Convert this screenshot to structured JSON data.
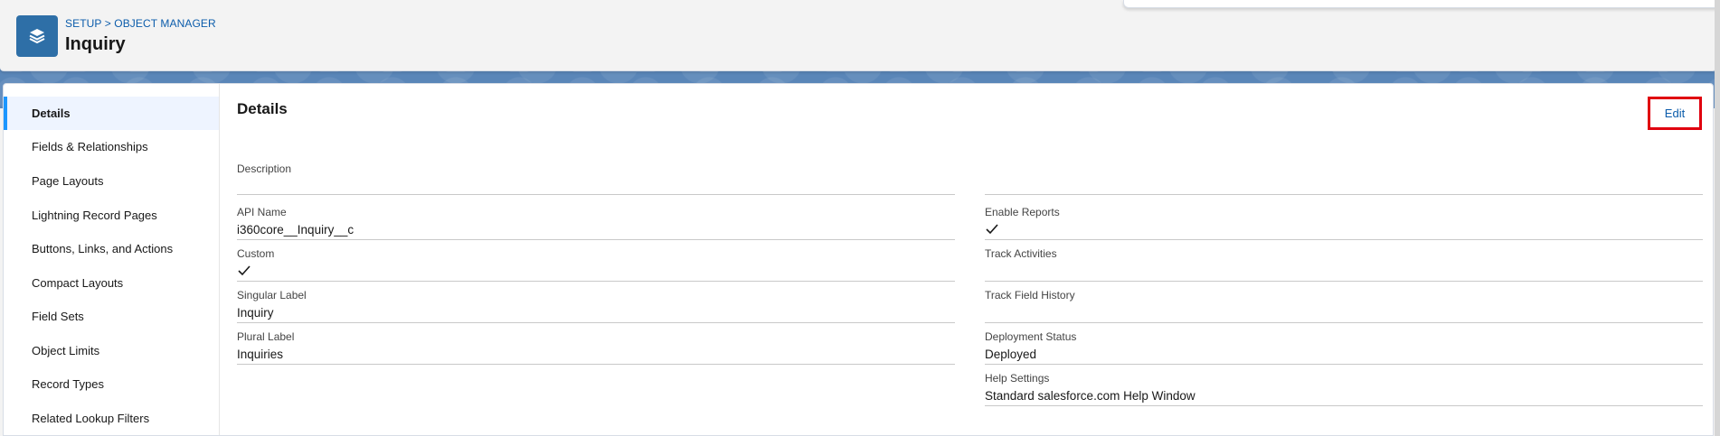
{
  "header": {
    "breadcrumb": "SETUP > OBJECT MANAGER",
    "title": "Inquiry",
    "icon": "layers-icon"
  },
  "sidebar": {
    "items": [
      {
        "label": "Details",
        "active": true
      },
      {
        "label": "Fields & Relationships"
      },
      {
        "label": "Page Layouts"
      },
      {
        "label": "Lightning Record Pages"
      },
      {
        "label": "Buttons, Links, and Actions"
      },
      {
        "label": "Compact Layouts"
      },
      {
        "label": "Field Sets"
      },
      {
        "label": "Object Limits"
      },
      {
        "label": "Record Types"
      },
      {
        "label": "Related Lookup Filters"
      }
    ]
  },
  "details": {
    "title": "Details",
    "edit_label": "Edit",
    "left": {
      "description_label": "Description",
      "description_value": "",
      "api_name_label": "API Name",
      "api_name_value": "i360core__Inquiry__c",
      "custom_label": "Custom",
      "custom_checked": true,
      "singular_label": "Singular Label",
      "singular_value": "Inquiry",
      "plural_label": "Plural Label",
      "plural_value": "Inquiries"
    },
    "right": {
      "enable_reports_label": "Enable Reports",
      "enable_reports_checked": true,
      "track_activities_label": "Track Activities",
      "track_field_history_label": "Track Field History",
      "deployment_status_label": "Deployment Status",
      "deployment_status_value": "Deployed",
      "help_settings_label": "Help Settings",
      "help_settings_value": "Standard salesforce.com Help Window"
    }
  },
  "colors": {
    "accent": "#0b5cab",
    "header_icon_bg": "#2e6fa7",
    "highlight_box": "#e0000e",
    "active_bar": "#1b96ff"
  }
}
